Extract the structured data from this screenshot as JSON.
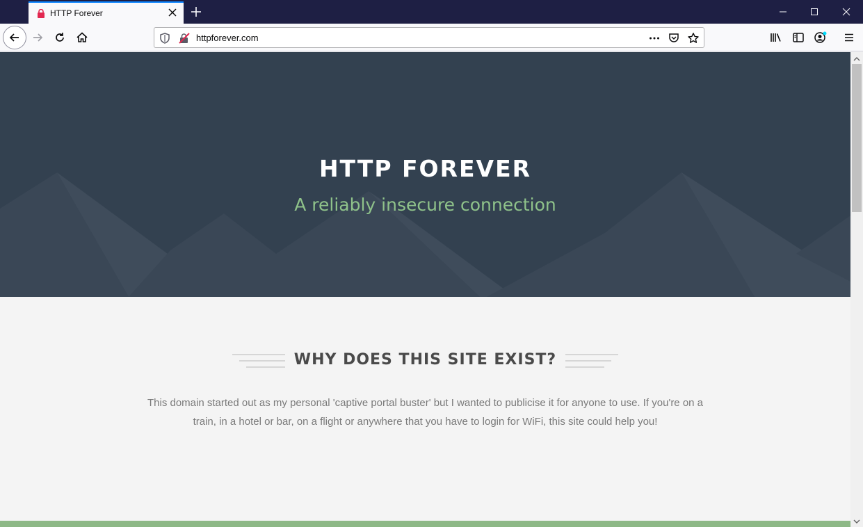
{
  "browser": {
    "tab_title": "HTTP Forever",
    "url": "httpforever.com",
    "icons": {
      "tab": "lock-icon",
      "back": "back-arrow-icon",
      "forward": "forward-arrow-icon",
      "reload": "reload-icon",
      "home": "home-icon",
      "shield": "shield-icon",
      "insecure": "insecure-lock-icon",
      "more": "more-icon",
      "pocket": "pocket-icon",
      "bookmark": "star-icon",
      "library": "library-icon",
      "sidebar": "sidebar-icon",
      "account": "account-icon",
      "menu": "hamburger-menu-icon"
    },
    "accent_color": "#0a84ff"
  },
  "hero": {
    "title": "HTTP FOREVER",
    "subtitle": "A reliably insecure connection",
    "background_color": "#334150",
    "subtitle_color": "#8fc28a"
  },
  "section": {
    "heading": "WHY DOES THIS SITE EXIST?",
    "body": "This domain started out as my personal 'captive portal buster' but I wanted to publicise it for anyone to use. If you're on a train, in a hotel or bar, on a flight or anywhere that you have to login for WiFi, this site could help you!"
  }
}
